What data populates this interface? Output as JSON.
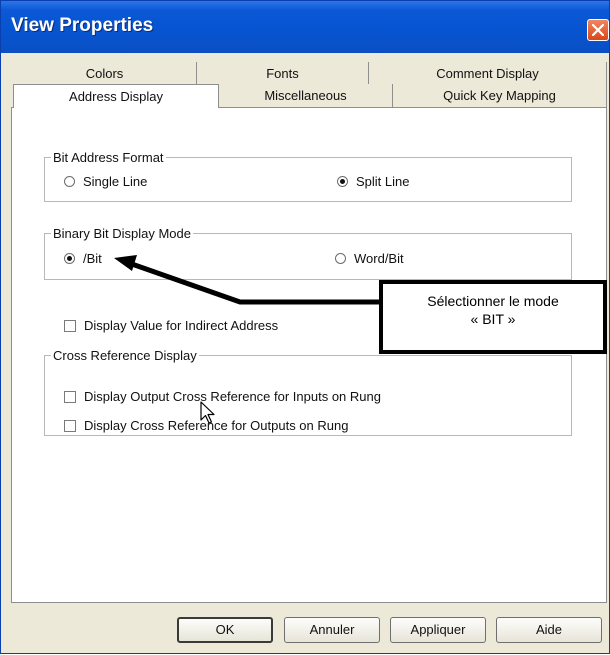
{
  "window": {
    "title": "View Properties"
  },
  "tabs": {
    "back_row": [
      {
        "label": "Colors"
      },
      {
        "label": "Fonts"
      },
      {
        "label": "Comment Display"
      }
    ],
    "front_row": [
      {
        "label": "Address Display",
        "selected": true
      },
      {
        "label": "Miscellaneous"
      },
      {
        "label": "Quick Key Mapping"
      }
    ]
  },
  "bit_address_format": {
    "legend": "Bit Address Format",
    "options": [
      {
        "label": "Single Line",
        "checked": false
      },
      {
        "label": "Split Line",
        "checked": true
      }
    ]
  },
  "binary_bit_display_mode": {
    "legend": "Binary Bit Display Mode",
    "options": [
      {
        "label": "/Bit",
        "checked": true
      },
      {
        "label": "Word/Bit",
        "checked": false
      }
    ]
  },
  "indirect_address": {
    "label": "Display Value for Indirect Address",
    "checked": false
  },
  "cross_reference_display": {
    "legend": "Cross Reference Display",
    "options": [
      {
        "label": "Display Output Cross Reference for Inputs on Rung",
        "checked": false
      },
      {
        "label": "Display Cross Reference for Outputs on Rung",
        "checked": false
      }
    ]
  },
  "callout": {
    "line1": "Sélectionner le mode",
    "line2": "« BIT »"
  },
  "buttons": {
    "ok": "OK",
    "cancel": "Annuler",
    "apply": "Appliquer",
    "help": "Aide"
  },
  "colors": {
    "titlebar": "#0754d0",
    "dialog_bg": "#ece9d8",
    "close_button": "#d9471b"
  }
}
